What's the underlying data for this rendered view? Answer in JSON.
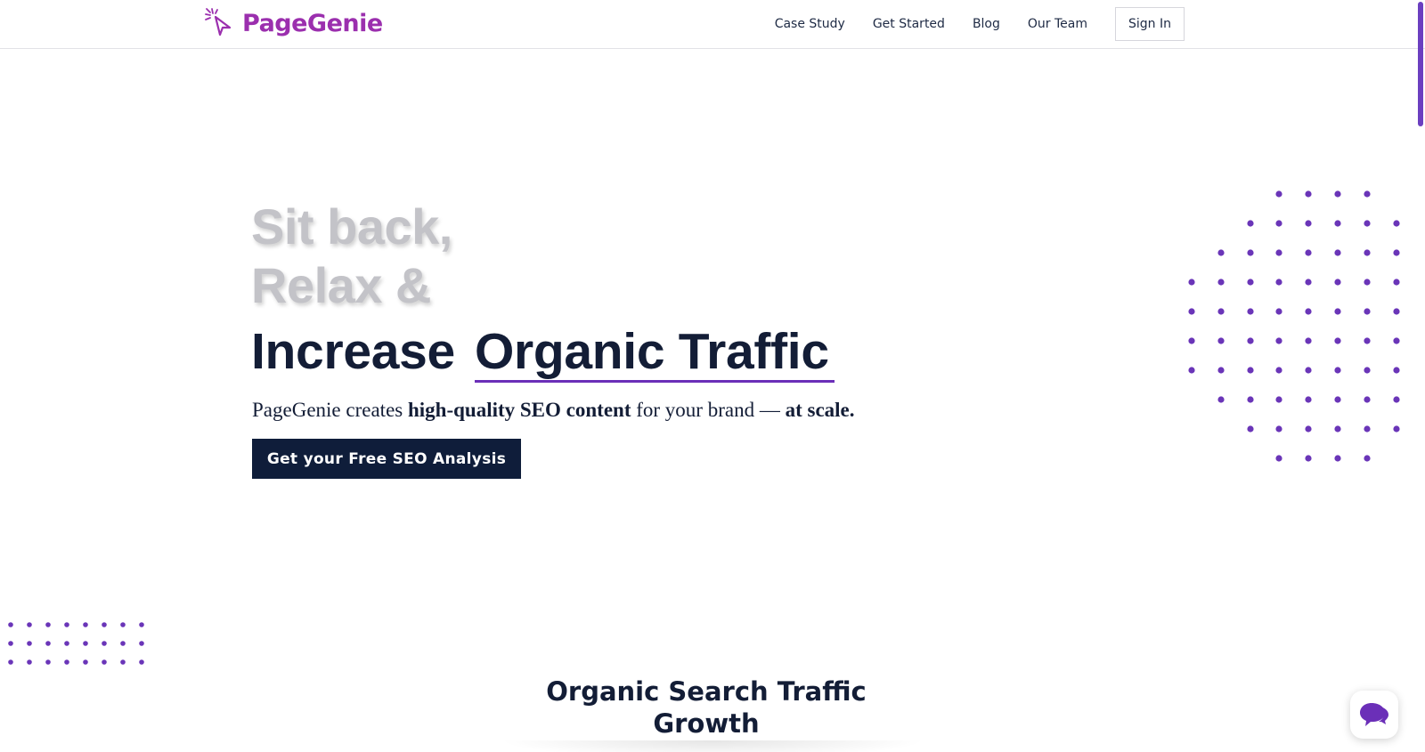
{
  "header": {
    "logo_text": "PageGenie",
    "nav": {
      "case_study": "Case Study",
      "get_started": "Get Started",
      "blog": "Blog",
      "our_team": "Our Team"
    },
    "sign_in": "Sign In"
  },
  "hero": {
    "line1": "Sit back,",
    "line2": "Relax &",
    "line3_lead": "Increase",
    "line3_accent": "Organic Traffic",
    "sub": {
      "brand": "PageGenie",
      "t1": " creates ",
      "b1": "high-quality SEO content",
      "t2": " for your brand — ",
      "b2": "at scale."
    },
    "cta": "Get your Free SEO Analysis"
  },
  "section": {
    "title_line1": "Organic Search Traffic",
    "title_line2": "Growth"
  },
  "icons": {
    "logo": "magic-wand-cursor-icon",
    "chat": "chat-bubbles-icon"
  },
  "colors": {
    "brand_purple": "#9b2fae",
    "accent_purple": "#6b2fb8",
    "dot_purple": "#6a35b8",
    "navy": "#0f1d3a",
    "faded_gray": "#c3c3c8"
  }
}
